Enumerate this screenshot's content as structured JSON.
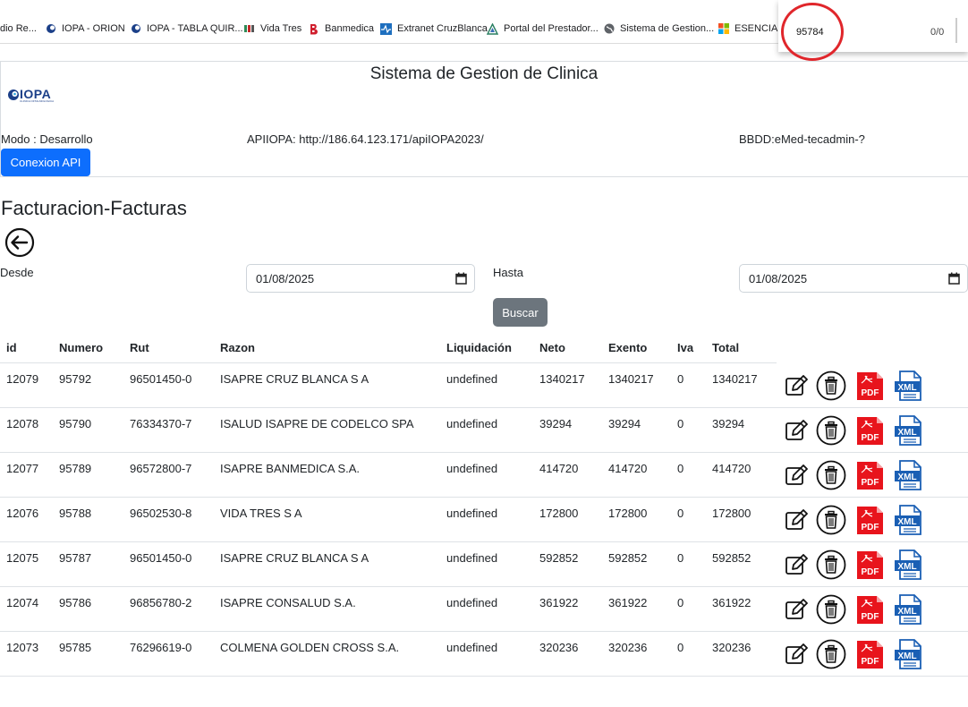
{
  "bookmarks": [
    {
      "label": "dio Re...",
      "icon": "none"
    },
    {
      "label": "IOPA - ORION",
      "icon": "iopa-icon"
    },
    {
      "label": "IOPA - TABLA QUIR...",
      "icon": "iopa-icon"
    },
    {
      "label": "Vida Tres",
      "icon": "vidatres-icon"
    },
    {
      "label": "Banmedica",
      "icon": "banmedica-icon"
    },
    {
      "label": "Extranet CruzBlanca",
      "icon": "cruzblanca-icon"
    },
    {
      "label": "Portal del Prestador...",
      "icon": "portal-icon"
    },
    {
      "label": "Sistema de Gestion...",
      "icon": "globe-icon"
    },
    {
      "label": "ESENCIAL",
      "icon": "windows-icon"
    }
  ],
  "popup": {
    "number": "95784",
    "count": "0/0"
  },
  "header": {
    "title": "Sistema de Gestion de Clinica",
    "logo_text": "IOPA",
    "logo_sub": "CLINICA OFTALMOLOGICA",
    "modo": "Modo : Desarrollo",
    "api": "APIIOPA: http://186.64.123.171/apiIOPA2023/",
    "bbdd": "BBDD:eMed-tecadmin-?",
    "api_button": "Conexion API"
  },
  "page": {
    "title": "Facturacion-Facturas",
    "desde_label": "Desde",
    "desde_value": "01/08/2025",
    "hasta_label": "Hasta",
    "hasta_value": "01/08/2025",
    "search_button": "Buscar"
  },
  "table": {
    "headers": [
      "id",
      "Numero",
      "Rut",
      "Razon",
      "Liquidación",
      "Neto",
      "Exento",
      "Iva",
      "Total"
    ],
    "rows": [
      [
        "12079",
        "95792",
        "96501450-0",
        "ISAPRE CRUZ BLANCA S A",
        "undefined",
        "1340217",
        "1340217",
        "0",
        "1340217"
      ],
      [
        "12078",
        "95790",
        "76334370-7",
        "ISALUD ISAPRE DE CODELCO SPA",
        "undefined",
        "39294",
        "39294",
        "0",
        "39294"
      ],
      [
        "12077",
        "95789",
        "96572800-7",
        "ISAPRE BANMEDICA S.A.",
        "undefined",
        "414720",
        "414720",
        "0",
        "414720"
      ],
      [
        "12076",
        "95788",
        "96502530-8",
        "VIDA TRES S A",
        "undefined",
        "172800",
        "172800",
        "0",
        "172800"
      ],
      [
        "12075",
        "95787",
        "96501450-0",
        "ISAPRE CRUZ BLANCA S A",
        "undefined",
        "592852",
        "592852",
        "0",
        "592852"
      ],
      [
        "12074",
        "95786",
        "96856780-2",
        "ISAPRE CONSALUD S.A.",
        "undefined",
        "361922",
        "361922",
        "0",
        "361922"
      ],
      [
        "12073",
        "95785",
        "76296619-0",
        "COLMENA GOLDEN CROSS S.A.",
        "undefined",
        "320236",
        "320236",
        "0",
        "320236"
      ]
    ],
    "action_labels": {
      "pdf": "PDF",
      "xml": "XML"
    }
  },
  "colors": {
    "primary": "#0d6efd",
    "secondary": "#6c757d",
    "pdf": "#e8141c",
    "xml": "#1a5fb4",
    "highlight": "#e0262b"
  }
}
